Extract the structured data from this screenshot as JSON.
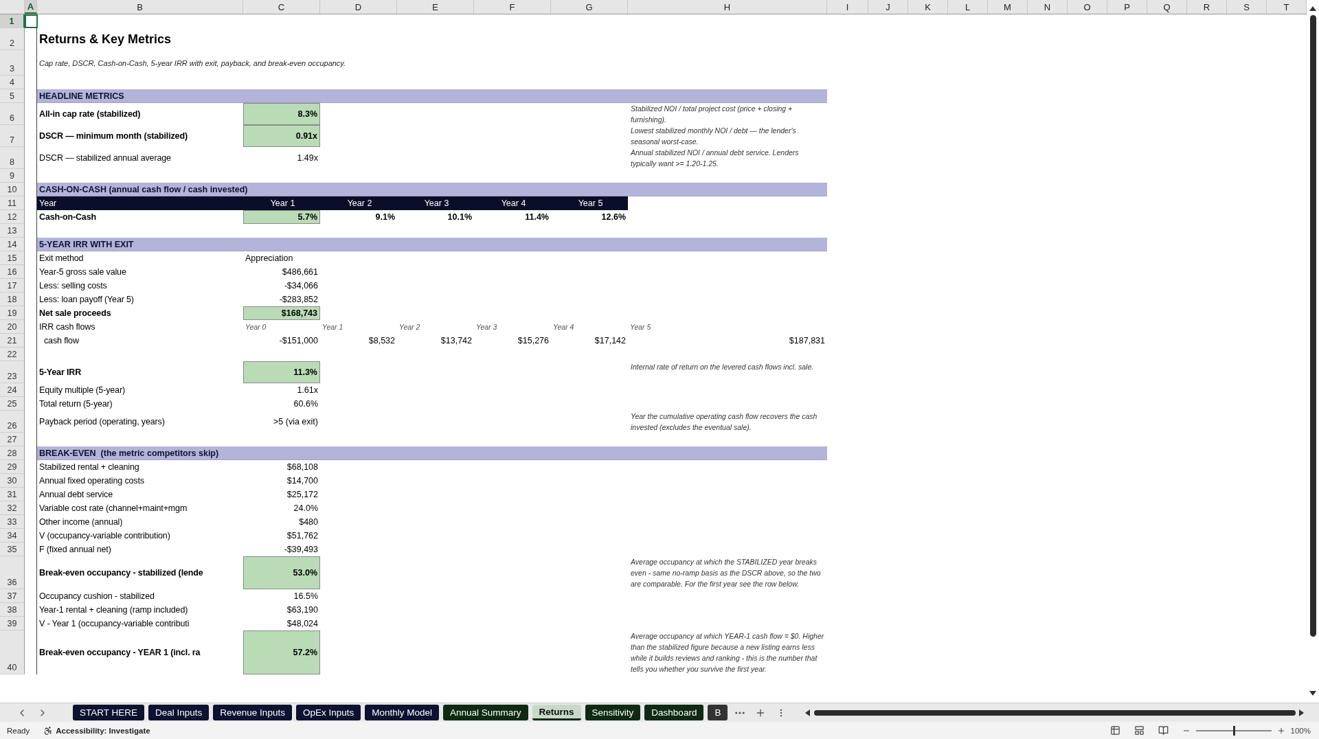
{
  "columns": [
    {
      "label": "A",
      "selected": true
    },
    {
      "label": "B",
      "selected": false
    },
    {
      "label": "C",
      "selected": false
    },
    {
      "label": "D",
      "selected": false
    },
    {
      "label": "E",
      "selected": false
    },
    {
      "label": "F",
      "selected": false
    },
    {
      "label": "G",
      "selected": false
    },
    {
      "label": "H",
      "selected": false
    },
    {
      "label": "I",
      "selected": false
    },
    {
      "label": "J",
      "selected": false
    },
    {
      "label": "K",
      "selected": false
    },
    {
      "label": "L",
      "selected": false
    },
    {
      "label": "M",
      "selected": false
    },
    {
      "label": "N",
      "selected": false
    },
    {
      "label": "O",
      "selected": false
    },
    {
      "label": "P",
      "selected": false
    },
    {
      "label": "Q",
      "selected": false
    },
    {
      "label": "R",
      "selected": false
    },
    {
      "label": "S",
      "selected": false
    },
    {
      "label": "T",
      "selected": false
    }
  ],
  "rows": [
    {
      "number": "1",
      "selected": true,
      "kind": "blank"
    },
    {
      "number": "2",
      "selected": false,
      "kind": "title",
      "label": "Returns & Key Metrics"
    },
    {
      "number": "3",
      "selected": false,
      "kind": "subtitle",
      "label": "Cap rate, DSCR, Cash-on-Cash, 5-year IRR with exit, payback, and break-even occupancy."
    },
    {
      "number": "4",
      "selected": false,
      "kind": "blank"
    },
    {
      "number": "5",
      "selected": false,
      "kind": "section",
      "label": "HEADLINE METRICS"
    },
    {
      "number": "6",
      "selected": false,
      "kind": "metric",
      "label": "All-in cap rate (stabilized)",
      "bold": true,
      "value": "8.3%",
      "highlight": true,
      "note": "Stabilized NOI / total project cost (price + closing + furnishing)."
    },
    {
      "number": "7",
      "selected": false,
      "kind": "metric",
      "label": "DSCR — minimum month (stabilized)",
      "bold": true,
      "value": "0.91x",
      "highlight": true,
      "note": "Lowest stabilized monthly NOI / debt — the lender's seasonal worst-case."
    },
    {
      "number": "8",
      "selected": false,
      "kind": "metric",
      "label": "DSCR — stabilized annual average",
      "bold": false,
      "value": "1.49x",
      "highlight": false,
      "note": "Annual stabilized NOI / annual debt service. Lenders typically want >= 1.20-1.25."
    },
    {
      "number": "9",
      "selected": false,
      "kind": "blank"
    },
    {
      "number": "10",
      "selected": false,
      "kind": "section",
      "label": "CASH-ON-CASH (annual cash flow / cash invested)"
    },
    {
      "number": "11",
      "selected": false,
      "kind": "band",
      "label": "Year",
      "values": [
        "Year 1",
        "Year 2",
        "Year 3",
        "Year 4",
        "Year 5"
      ]
    },
    {
      "number": "12",
      "selected": false,
      "kind": "values",
      "label": "Cash-on-Cash",
      "bold": true,
      "values": [
        {
          "text": "5.7%",
          "highlight": true
        },
        {
          "text": "9.1%",
          "highlight": false
        },
        {
          "text": "10.1%",
          "highlight": false
        },
        {
          "text": "11.4%",
          "highlight": false
        },
        {
          "text": "12.6%",
          "highlight": false
        }
      ]
    },
    {
      "number": "13",
      "selected": false,
      "kind": "blank"
    },
    {
      "number": "14",
      "selected": false,
      "kind": "section",
      "label": "5-YEAR IRR WITH EXIT"
    },
    {
      "number": "15",
      "selected": false,
      "kind": "text_pair",
      "label": "Exit method",
      "value": "Appreciation"
    },
    {
      "number": "16",
      "selected": false,
      "kind": "metric",
      "label": "Year-5 gross sale value",
      "bold": false,
      "value": "$486,661",
      "highlight": false
    },
    {
      "number": "17",
      "selected": false,
      "kind": "metric",
      "label": "Less: selling costs",
      "bold": false,
      "value": "-$34,066",
      "highlight": false
    },
    {
      "number": "18",
      "selected": false,
      "kind": "metric",
      "label": "Less: loan payoff (Year 5)",
      "bold": false,
      "value": "-$283,852",
      "highlight": false
    },
    {
      "number": "19",
      "selected": false,
      "kind": "metric",
      "label": "Net sale proceeds",
      "bold": true,
      "value": "$168,743",
      "highlight": true
    },
    {
      "number": "20",
      "selected": false,
      "kind": "year_labels",
      "label": "IRR cash flows",
      "values": [
        "Year 0",
        "Year 1",
        "Year 2",
        "Year 3",
        "Year 4",
        "Year 5"
      ]
    },
    {
      "number": "21",
      "selected": false,
      "kind": "values",
      "label": "cash flow",
      "bold": false,
      "indent": true,
      "values": [
        {
          "text": "-$151,000",
          "highlight": false
        },
        {
          "text": "$8,532",
          "highlight": false
        },
        {
          "text": "$13,742",
          "highlight": false
        },
        {
          "text": "$15,276",
          "highlight": false
        },
        {
          "text": "$17,142",
          "highlight": false
        },
        {
          "text": "$187,831",
          "highlight": false
        }
      ]
    },
    {
      "number": "22",
      "selected": false,
      "kind": "blank"
    },
    {
      "number": "23",
      "selected": false,
      "kind": "metric",
      "label": "5-Year IRR",
      "bold": true,
      "value": "11.3%",
      "highlight": true,
      "note": "Internal rate of return on the levered cash flows incl. sale."
    },
    {
      "number": "24",
      "selected": false,
      "kind": "metric",
      "label": "Equity multiple (5-year)",
      "bold": false,
      "value": "1.61x",
      "highlight": false
    },
    {
      "number": "25",
      "selected": false,
      "kind": "metric",
      "label": "Total return (5-year)",
      "bold": false,
      "value": "60.6%",
      "highlight": false
    },
    {
      "number": "26",
      "selected": false,
      "kind": "metric",
      "label": "Payback period (operating, years)",
      "bold": false,
      "value": ">5 (via exit)",
      "highlight": false,
      "note": "Year the cumulative operating cash flow recovers the cash invested (excludes the eventual sale)."
    },
    {
      "number": "27",
      "selected": false,
      "kind": "blank"
    },
    {
      "number": "28",
      "selected": false,
      "kind": "section",
      "label": "BREAK-EVEN  (the metric competitors skip)"
    },
    {
      "number": "29",
      "selected": false,
      "kind": "metric",
      "label": "Stabilized rental + cleaning",
      "bold": false,
      "value": "$68,108",
      "highlight": false
    },
    {
      "number": "30",
      "selected": false,
      "kind": "metric",
      "label": "Annual fixed operating costs",
      "bold": false,
      "value": "$14,700",
      "highlight": false
    },
    {
      "number": "31",
      "selected": false,
      "kind": "metric",
      "label": "Annual debt service",
      "bold": false,
      "value": "$25,172",
      "highlight": false
    },
    {
      "number": "32",
      "selected": false,
      "kind": "metric",
      "label": "Variable cost rate (channel+maint+mgm",
      "bold": false,
      "value": "24.0%",
      "highlight": false
    },
    {
      "number": "33",
      "selected": false,
      "kind": "metric",
      "label": "Other income (annual)",
      "bold": false,
      "value": "$480",
      "highlight": false
    },
    {
      "number": "34",
      "selected": false,
      "kind": "metric",
      "label": "V (occupancy-variable contribution)",
      "bold": false,
      "value": "$51,762",
      "highlight": false
    },
    {
      "number": "35",
      "selected": false,
      "kind": "metric",
      "label": "F (fixed annual net)",
      "bold": false,
      "value": "-$39,493",
      "highlight": false
    },
    {
      "number": "36",
      "selected": false,
      "kind": "metric",
      "label": "Break-even occupancy - stabilized (lende",
      "bold": true,
      "value": "53.0%",
      "highlight": true,
      "note": "Average occupancy at which the STABILIZED year breaks even - same no-ramp basis as the DSCR above, so the two are comparable. For the first year see the row below."
    },
    {
      "number": "37",
      "selected": false,
      "kind": "metric",
      "label": "Occupancy cushion - stabilized",
      "bold": false,
      "value": "16.5%",
      "highlight": false
    },
    {
      "number": "38",
      "selected": false,
      "kind": "metric",
      "label": "Year-1 rental + cleaning (ramp included)",
      "bold": false,
      "value": "$63,190",
      "highlight": false
    },
    {
      "number": "39",
      "selected": false,
      "kind": "metric",
      "label": "V - Year 1 (occupancy-variable contributi",
      "bold": false,
      "value": "$48,024",
      "highlight": false
    },
    {
      "number": "40",
      "selected": false,
      "kind": "metric",
      "label": "Break-even occupancy - YEAR 1 (incl. ra",
      "bold": true,
      "value": "57.2%",
      "highlight": true,
      "note": "Average occupancy at which YEAR-1 cash flow = $0. Higher than the stabilized figure because a new listing earns less while it builds reviews and ranking - this is the number that tells you whether you survive the first year."
    }
  ],
  "tabs": [
    {
      "label": "START HERE",
      "color": "#0c1230",
      "selected": false
    },
    {
      "label": "Deal Inputs",
      "color": "#0c1230",
      "selected": false
    },
    {
      "label": "Revenue Inputs",
      "color": "#0c1230",
      "selected": false
    },
    {
      "label": "OpEx Inputs",
      "color": "#0c1230",
      "selected": false
    },
    {
      "label": "Monthly Model",
      "color": "#0c1230",
      "selected": false
    },
    {
      "label": "Annual Summary",
      "color": "#0f2a12",
      "selected": false
    },
    {
      "label": "Returns",
      "color": "#0f2a12",
      "selected": true
    },
    {
      "label": "Sensitivity",
      "color": "#0f2a12",
      "selected": false
    },
    {
      "label": "Dashboard",
      "color": "#0f2a12",
      "selected": false
    },
    {
      "label": "B",
      "color": "#333333",
      "selected": false
    }
  ],
  "status_bar": {
    "status": "Ready",
    "accessibility": "Accessibility: Investigate",
    "zoom": "100%",
    "zoom_slider": {
      "level": 0.5
    }
  }
}
